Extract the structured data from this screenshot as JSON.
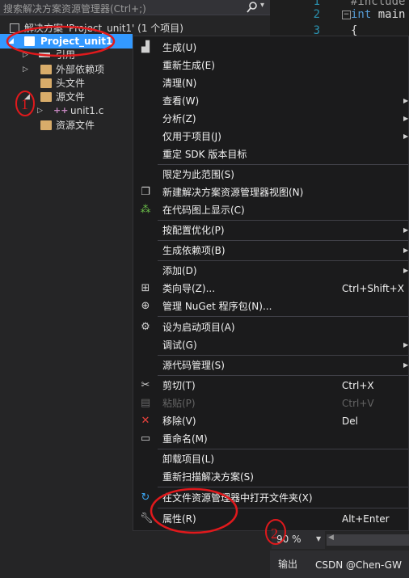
{
  "search": {
    "placeholder": "搜索解决方案资源管理器(Ctrl+;)",
    "icon": "search-icon"
  },
  "tree": {
    "solution": "解决方案 'Project_unit1' (1 个项目)",
    "project": "Project_unit1",
    "references": "引用",
    "external_deps": "外部依赖项",
    "header_files": "头文件",
    "source_files": "源文件",
    "unit1": "unit1.c",
    "resource_files": "资源文件"
  },
  "editor": {
    "line_numbers": [
      "1",
      "2",
      "3"
    ],
    "line1": "#include",
    "line2_kw": "int",
    "line2_rest": " main",
    "line3": "{"
  },
  "menu": {
    "items": [
      {
        "label": "生成(U)",
        "icon": "build-icon"
      },
      {
        "label": "重新生成(E)"
      },
      {
        "label": "清理(N)"
      },
      {
        "label": "查看(W)",
        "submenu": true
      },
      {
        "label": "分析(Z)",
        "submenu": true
      },
      {
        "label": "仅用于项目(J)",
        "submenu": true
      },
      {
        "label": "重定 SDK 版本目标"
      },
      {
        "label": "限定为此范围(S)"
      },
      {
        "label": "新建解决方案资源管理器视图(N)",
        "icon": "new-view-icon"
      },
      {
        "label": "在代码图上显示(C)",
        "icon": "code-map-icon"
      },
      {
        "label": "按配置优化(P)",
        "submenu": true
      },
      {
        "label": "生成依赖项(B)",
        "submenu": true
      },
      {
        "label": "添加(D)",
        "submenu": true
      },
      {
        "label": "类向导(Z)...",
        "shortcut": "Ctrl+Shift+X",
        "icon": "class-wizard-icon"
      },
      {
        "label": "管理 NuGet 程序包(N)...",
        "icon": "nuget-icon"
      },
      {
        "label": "设为启动项目(A)",
        "icon": "gear-icon"
      },
      {
        "label": "调试(G)",
        "submenu": true
      },
      {
        "label": "源代码管理(S)",
        "submenu": true
      },
      {
        "label": "剪切(T)",
        "shortcut": "Ctrl+X",
        "icon": "scissors-icon"
      },
      {
        "label": "粘贴(P)",
        "shortcut": "Ctrl+V",
        "icon": "paste-icon",
        "disabled": true
      },
      {
        "label": "移除(V)",
        "shortcut": "Del",
        "icon": "remove-icon"
      },
      {
        "label": "重命名(M)",
        "icon": "rename-icon"
      },
      {
        "label": "卸载项目(L)"
      },
      {
        "label": "重新扫描解决方案(S)"
      },
      {
        "label": "在文件资源管理器中打开文件夹(X)",
        "icon": "open-folder-icon"
      },
      {
        "label": "属性(R)",
        "shortcut": "Alt+Enter",
        "icon": "wrench-icon"
      }
    ]
  },
  "bottom": {
    "zoom": "90 %",
    "output": "输出",
    "watermark": "CSDN @Chen-GW"
  },
  "annotations": {
    "marker1": "1",
    "marker2": "2",
    "color": "#e0191c"
  }
}
